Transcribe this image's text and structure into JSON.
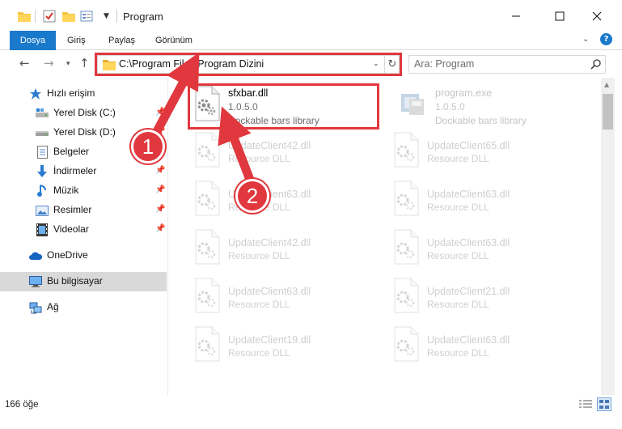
{
  "window": {
    "title": "Program",
    "minimize_label": "Simge durumuna küçült",
    "maximize_label": "Ekranı kapla",
    "close_label": "Kapat"
  },
  "ribbon": {
    "tabs": [
      "Dosya",
      "Giriş",
      "Paylaş",
      "Görünüm"
    ]
  },
  "nav": {
    "address": "C:\\Program Files\\Program Dizini",
    "search_placeholder": "Ara: Program"
  },
  "sidebar": {
    "items": [
      {
        "label": "Hızlı erişim",
        "icon": "star-icon"
      },
      {
        "label": "Yerel Disk (C:)",
        "icon": "drive-icon"
      },
      {
        "label": "Yerel Disk (D:)",
        "icon": "drive-icon"
      },
      {
        "label": "Belgeler",
        "icon": "documents-icon"
      },
      {
        "label": "İndirmeler",
        "icon": "download-icon"
      },
      {
        "label": "Müzik",
        "icon": "music-icon"
      },
      {
        "label": "Resimler",
        "icon": "pictures-icon"
      },
      {
        "label": "Videolar",
        "icon": "video-icon"
      },
      {
        "label": "OneDrive",
        "icon": "cloud-icon"
      },
      {
        "label": "Bu bilgisayar",
        "icon": "computer-icon"
      },
      {
        "label": "Ağ",
        "icon": "network-icon"
      }
    ]
  },
  "files": [
    {
      "name": "sfxbar.dll",
      "version": "1.0.5.0",
      "description": "Dockable bars library"
    },
    {
      "name": "program.exe",
      "version": "1.0.5.0",
      "description": "Dockable bars library"
    },
    {
      "name": "UpdateClient42.dll",
      "description": "Resource DLL"
    },
    {
      "name": "UpdateClient65.dll",
      "description": "Resource DLL"
    },
    {
      "name": "UpdateClient63.dll",
      "description": "Resource DLL"
    },
    {
      "name": "UpdateClient63.dll",
      "description": "Resource DLL"
    },
    {
      "name": "UpdateClient42.dll",
      "description": "Resource DLL"
    },
    {
      "name": "UpdateClient63.dll",
      "description": "Resource DLL"
    },
    {
      "name": "UpdateClient63.dll",
      "description": "Resource DLL"
    },
    {
      "name": "UpdateClient21.dll",
      "description": "Resource DLL"
    },
    {
      "name": "UpdateClient19.dll",
      "description": "Resource DLL"
    },
    {
      "name": "UpdateClient63.dll",
      "description": "Resource DLL"
    }
  ],
  "status": {
    "count": "166 öğe"
  },
  "callouts": [
    "1",
    "2"
  ],
  "colors": {
    "accent": "#1979ca",
    "highlight": "#e0383e"
  }
}
